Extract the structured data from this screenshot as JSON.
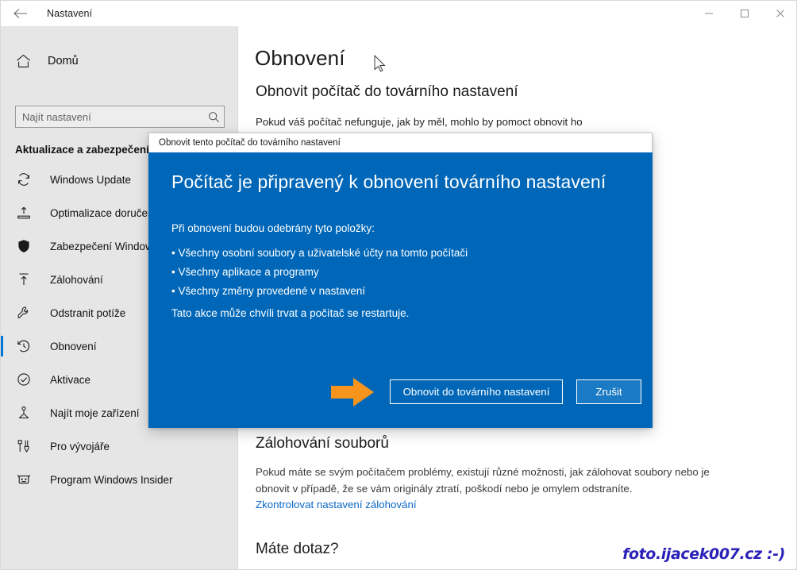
{
  "window": {
    "title": "Nastavení",
    "back_icon": "back-arrow-icon",
    "minimize_label": "—",
    "maximize_label": "□",
    "close_label": "✕"
  },
  "sidebar": {
    "home_label": "Domů",
    "home_icon": "home-icon",
    "search": {
      "placeholder": "Najít nastavení",
      "value": "",
      "icon": "search-icon"
    },
    "category_title": "Aktualizace a zabezpečení",
    "accent_color": "#0078d7",
    "items": [
      {
        "label": "Windows Update",
        "icon": "sync-icon",
        "selected": false
      },
      {
        "label": "Optimalizace doručení",
        "icon": "delivery-optimization-icon",
        "selected": false
      },
      {
        "label": "Zabezpečení Windows",
        "icon": "shield-icon",
        "selected": false
      },
      {
        "label": "Zálohování",
        "icon": "upload-icon",
        "selected": false
      },
      {
        "label": "Odstranit potíže",
        "icon": "wrench-icon",
        "selected": false
      },
      {
        "label": "Obnovení",
        "icon": "history-clock-icon",
        "selected": true
      },
      {
        "label": "Aktivace",
        "icon": "check-circle-icon",
        "selected": false
      },
      {
        "label": "Najít moje zařízení",
        "icon": "find-device-icon",
        "selected": false
      },
      {
        "label": "Pro vývojáře",
        "icon": "developer-tools-icon",
        "selected": false
      },
      {
        "label": "Program Windows Insider",
        "icon": "insider-bug-icon",
        "selected": false
      }
    ]
  },
  "main": {
    "page_title": "Obnovení",
    "section_reset": {
      "heading": "Obnovit počítač do továrního nastavení",
      "body": "Pokud váš počítač nefunguje, jak by měl, mohlo by pomoct obnovit ho"
    },
    "section_backup": {
      "heading": "Zálohování souborů",
      "body": "Pokud máte se svým počítačem problémy, existují různé možnosti, jak zálohovat soubory nebo je obnovit v případě, že se vám originály ztratí, poškodí nebo je omylem odstraníte.",
      "link": "Zkontrolovat nastavení zálohování"
    },
    "section_question": {
      "heading": "Máte dotaz?"
    }
  },
  "dialog": {
    "title": "Obnovit tento počítač do továrního nastavení",
    "heading": "Počítač je připravený k obnovení továrního nastavení",
    "intro": "Při obnovení budou odebrány tyto položky:",
    "bullets": [
      "• Všechny osobní soubory a uživatelské účty na tomto počítači",
      "• Všechny aplikace a programy",
      "• Všechny změny provedené v nastavení"
    ],
    "note": "Tato akce může chvíli trvat a počítač se restartuje.",
    "primary_button": "Obnovit do továrního nastavení",
    "secondary_button": "Zrušit",
    "background_color": "#0067b8",
    "annotation_arrow_color": "#f7941e",
    "annotation_icon": "orange-arrow-icon"
  },
  "overlay": {
    "watermark": "foto.ijacek007.cz :-)",
    "watermark_color": "#2a21b8",
    "cursor_icon": "mouse-pointer-icon"
  }
}
